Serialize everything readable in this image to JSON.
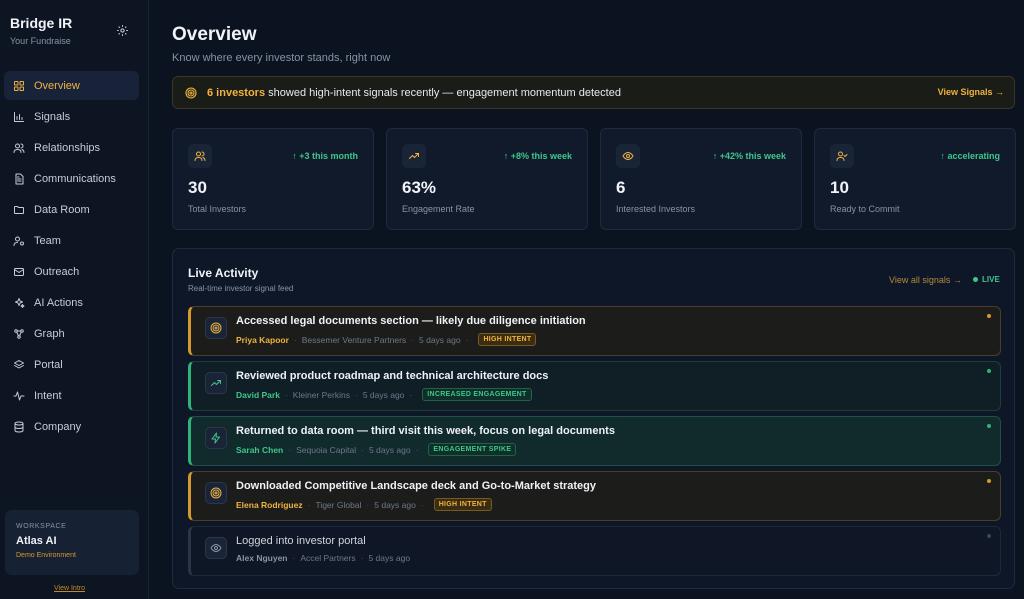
{
  "sidebar": {
    "brand": "Bridge IR",
    "brand_sub": "Your Fundraise",
    "items": [
      {
        "label": "Overview",
        "icon": "grid-icon",
        "active": true
      },
      {
        "label": "Signals",
        "icon": "bar-chart-icon"
      },
      {
        "label": "Relationships",
        "icon": "users-icon"
      },
      {
        "label": "Communications",
        "icon": "document-icon"
      },
      {
        "label": "Data Room",
        "icon": "folder-icon"
      },
      {
        "label": "Team",
        "icon": "user-cog-icon"
      },
      {
        "label": "Outreach",
        "icon": "mail-icon"
      },
      {
        "label": "AI Actions",
        "icon": "sparkles-icon"
      },
      {
        "label": "Graph",
        "icon": "graph-icon"
      },
      {
        "label": "Portal",
        "icon": "layers-icon"
      },
      {
        "label": "Intent",
        "icon": "pulse-icon"
      },
      {
        "label": "Company",
        "icon": "database-icon"
      }
    ],
    "workspace": {
      "kicker": "WORKSPACE",
      "name": "Atlas AI",
      "env": "Demo Environment"
    },
    "view_intro": "View Intro"
  },
  "header": {
    "title": "Overview",
    "subtitle": "Know where every investor stands, right now"
  },
  "banner": {
    "highlight": "6 investors",
    "text": " showed high-intent signals recently — engagement momentum detected",
    "link": "View Signals →"
  },
  "stats": [
    {
      "icon": "users-icon",
      "trend": "↑ +3 this month",
      "value": "30",
      "label": "Total Investors"
    },
    {
      "icon": "trending-up-icon",
      "trend": "↑ +8% this week",
      "value": "63%",
      "label": "Engagement Rate"
    },
    {
      "icon": "eye-icon",
      "trend": "↑ +42% this week",
      "value": "6",
      "label": "Interested Investors"
    },
    {
      "icon": "user-check-icon",
      "trend": "↑ accelerating",
      "value": "10",
      "label": "Ready to Commit"
    }
  ],
  "activity": {
    "title": "Live Activity",
    "subtitle": "Real-time investor signal feed",
    "view_all": "View all signals →",
    "live": "LIVE",
    "items": [
      {
        "title": "Accessed legal documents section — likely due diligence initiation",
        "person": "Priya Kapoor",
        "firm": "Bessemer Venture Partners",
        "time": "5 days ago",
        "badge": "HIGH INTENT",
        "tone": "gold",
        "icon": "target-icon"
      },
      {
        "title": "Reviewed product roadmap and technical architecture docs",
        "person": "David Park",
        "firm": "Kleiner Perkins",
        "time": "5 days ago",
        "badge": "INCREASED ENGAGEMENT",
        "tone": "green",
        "icon": "trending-up-icon"
      },
      {
        "title": "Returned to data room — third visit this week, focus on legal documents",
        "person": "Sarah Chen",
        "firm": "Sequoia Capital",
        "time": "5 days ago",
        "badge": "ENGAGEMENT SPIKE",
        "tone": "green2",
        "icon": "zap-icon"
      },
      {
        "title": "Downloaded Competitive Landscape deck and Go-to-Market strategy",
        "person": "Elena Rodriguez",
        "firm": "Tiger Global",
        "time": "5 days ago",
        "badge": "HIGH INTENT",
        "tone": "gold",
        "icon": "target-icon"
      },
      {
        "title": "Logged into investor portal",
        "person": "Alex Nguyen",
        "firm": "Accel Partners",
        "time": "5 days ago",
        "badge": "",
        "tone": "grey",
        "icon": "eye-icon"
      }
    ]
  },
  "colors": {
    "accent": "#f0b340",
    "positive": "#3fc68b",
    "background": "#0b1220"
  }
}
